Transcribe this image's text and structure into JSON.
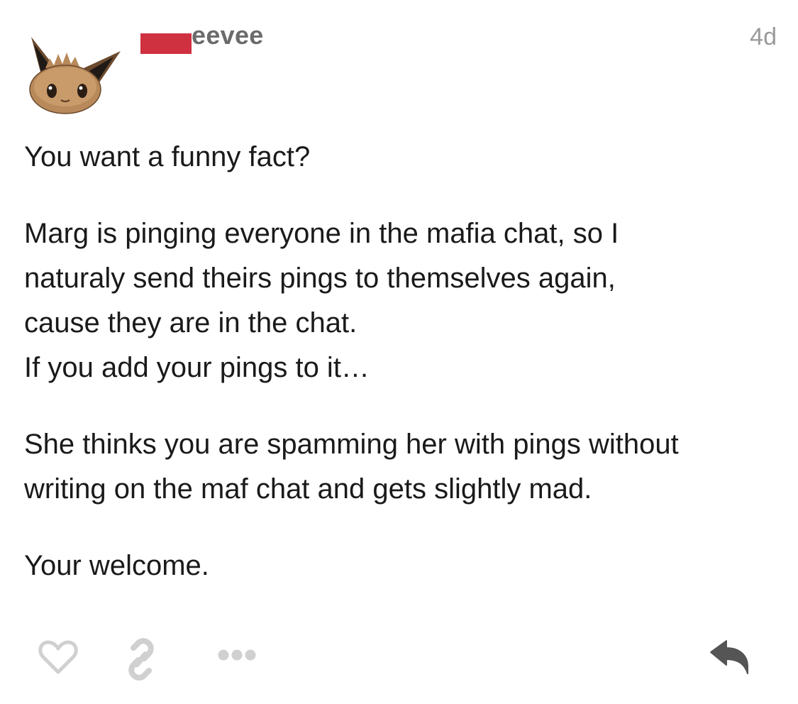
{
  "post": {
    "username": "eevee",
    "timestamp": "4d",
    "paragraphs": [
      {
        "lines": [
          "You want a funny fact?"
        ]
      },
      {
        "lines": [
          "Marg is pinging everyone in the mafia chat, so I",
          "naturaly send theirs pings to themselves again,",
          "cause they are in the chat.",
          "If you add your pings to it…"
        ]
      },
      {
        "lines": [
          "She thinks you are spamming her with pings without",
          "writing on the maf chat and gets slightly mad."
        ]
      },
      {
        "lines": [
          "Your welcome."
        ]
      }
    ]
  },
  "actions": {
    "icons": [
      "heart-icon",
      "link-icon",
      "more-icon",
      "reply-icon"
    ]
  },
  "colors": {
    "redaction": "#cf3140",
    "username": "#6b6b6b",
    "timestamp": "#9a9a9a",
    "icon": "#d0d0d0",
    "reply_icon": "#555555"
  }
}
